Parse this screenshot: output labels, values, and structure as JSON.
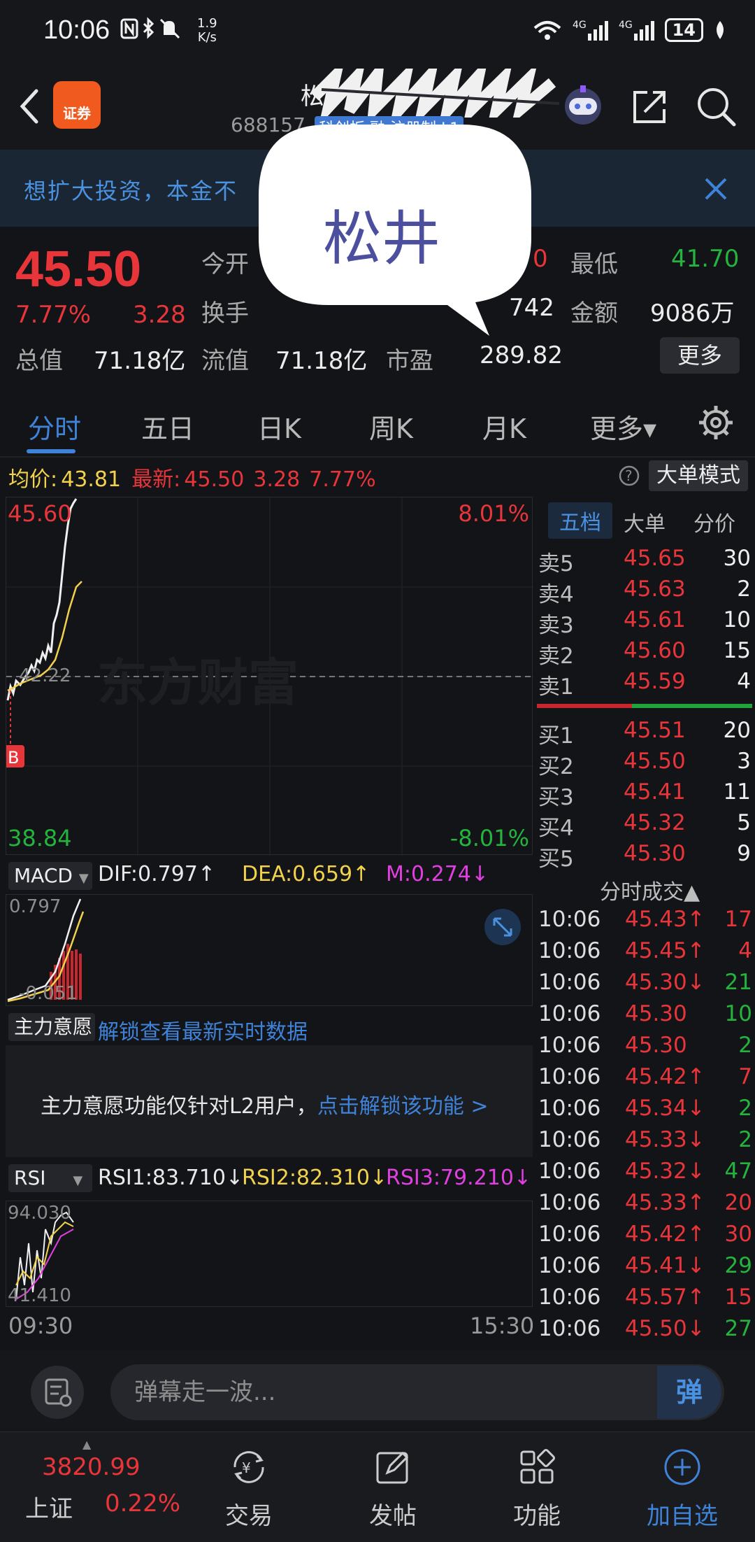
{
  "status": {
    "time": "10:06",
    "net_speed_top": "1.9",
    "net_speed_bottom": "K/s",
    "battery": "14"
  },
  "header": {
    "app_logo_text": "证券",
    "stock_name": "松",
    "stock_code": "688157",
    "stock_tags": "科创板 融 注册制 L1"
  },
  "banner": {
    "text": "想扩大投资，本金不"
  },
  "overlay": {
    "text": "松井"
  },
  "quote": {
    "price": "45.50",
    "change_pct": "7.77%",
    "change_abs": "3.28",
    "open_label": "今开",
    "turnover_label": "换手",
    "low_label": "最低",
    "low_value": "41.70",
    "amount_label": "金额",
    "amount_value": "9086万",
    "high_partial": "0",
    "volume_partial": "742",
    "total_cap_label": "总值",
    "total_cap_value": "71.18亿",
    "float_cap_label": "流值",
    "float_cap_value": "71.18亿",
    "pe_label": "市盈",
    "pe_value": "289.82",
    "more_label": "更多"
  },
  "tabs": [
    {
      "label": "分时"
    },
    {
      "label": "五日"
    },
    {
      "label": "日K"
    },
    {
      "label": "周K"
    },
    {
      "label": "月K"
    },
    {
      "label": "更多▾"
    }
  ],
  "avgbar": {
    "avg_label": "均价:",
    "avg_value": "43.81",
    "latest_label": "最新:",
    "latest_value": "45.50",
    "latest_change": "3.28",
    "latest_pct": "7.77%",
    "bigorder_label": "大单模式"
  },
  "chart": {
    "top_price": "45.60",
    "top_pct": "8.01%",
    "bottom_price": "38.84",
    "bottom_pct": "-8.01%",
    "mid_price": "42.22",
    "b_marker": "B",
    "watermark": "东方财富",
    "time_start": "09:30",
    "time_end": "15:30"
  },
  "macd": {
    "button": "MACD",
    "dif": "DIF:0.797↑",
    "dea": "DEA:0.659↑",
    "m": "M:0.274↓",
    "top": "0.797",
    "bottom": "-0.051"
  },
  "zhuli": {
    "button": "主力意愿",
    "unlock": "解锁查看最新实时数据",
    "message": "主力意愿功能仅针对L2用户，",
    "link": "点击解锁该功能 >"
  },
  "rsi": {
    "button": "RSI",
    "rsi1": "RSI1:83.710↓",
    "rsi2": "RSI2:82.310↓",
    "rsi3": "RSI3:79.210↓",
    "top": "94.030",
    "bottom": "41.410"
  },
  "orderbook": {
    "tabs": [
      "五档",
      "大单",
      "分价"
    ],
    "asks": [
      {
        "label": "卖5",
        "price": "45.65",
        "vol": "30"
      },
      {
        "label": "卖4",
        "price": "45.63",
        "vol": "2"
      },
      {
        "label": "卖3",
        "price": "45.61",
        "vol": "10"
      },
      {
        "label": "卖2",
        "price": "45.60",
        "vol": "15"
      },
      {
        "label": "卖1",
        "price": "45.59",
        "vol": "4"
      }
    ],
    "bids": [
      {
        "label": "买1",
        "price": "45.51",
        "vol": "20"
      },
      {
        "label": "买2",
        "price": "45.50",
        "vol": "3"
      },
      {
        "label": "买3",
        "price": "45.41",
        "vol": "11"
      },
      {
        "label": "买4",
        "price": "45.32",
        "vol": "5"
      },
      {
        "label": "买5",
        "price": "45.30",
        "vol": "9"
      }
    ]
  },
  "trades": {
    "title": "分时成交▲",
    "rows": [
      {
        "time": "10:06",
        "price": "45.43↑",
        "vol": "17",
        "dir": "up"
      },
      {
        "time": "10:06",
        "price": "45.45↑",
        "vol": "4",
        "dir": "up"
      },
      {
        "time": "10:06",
        "price": "45.30↓",
        "vol": "21",
        "dir": "down"
      },
      {
        "time": "10:06",
        "price": "45.30",
        "vol": "10",
        "dir": "none"
      },
      {
        "time": "10:06",
        "price": "45.30",
        "vol": "2",
        "dir": "none"
      },
      {
        "time": "10:06",
        "price": "45.42↑",
        "vol": "7",
        "dir": "up"
      },
      {
        "time": "10:06",
        "price": "45.34↓",
        "vol": "2",
        "dir": "down"
      },
      {
        "time": "10:06",
        "price": "45.33↓",
        "vol": "2",
        "dir": "down"
      },
      {
        "time": "10:06",
        "price": "45.32↓",
        "vol": "47",
        "dir": "down"
      },
      {
        "time": "10:06",
        "price": "45.33↑",
        "vol": "20",
        "dir": "up"
      },
      {
        "time": "10:06",
        "price": "45.42↑",
        "vol": "30",
        "dir": "up"
      },
      {
        "time": "10:06",
        "price": "45.41↓",
        "vol": "29",
        "dir": "down"
      },
      {
        "time": "10:06",
        "price": "45.57↑",
        "vol": "15",
        "dir": "up"
      },
      {
        "time": "10:06",
        "price": "45.50↓",
        "vol": "27",
        "dir": "down"
      }
    ]
  },
  "comment": {
    "placeholder": "弹幕走一波...",
    "danmu_label": "弹"
  },
  "bottomnav": {
    "index_value": "3820.99",
    "index_name": "上证",
    "index_change": "0.22%",
    "items": [
      {
        "label": "交易",
        "icon": "trade-yen-icon"
      },
      {
        "label": "发帖",
        "icon": "edit-post-icon"
      },
      {
        "label": "功能",
        "icon": "grid-function-icon"
      },
      {
        "label": "加自选",
        "icon": "add-circle-icon"
      }
    ]
  },
  "colors": {
    "up": "#e8353a",
    "down": "#24b33d",
    "accent": "#3f83d9",
    "background": "#131418"
  }
}
